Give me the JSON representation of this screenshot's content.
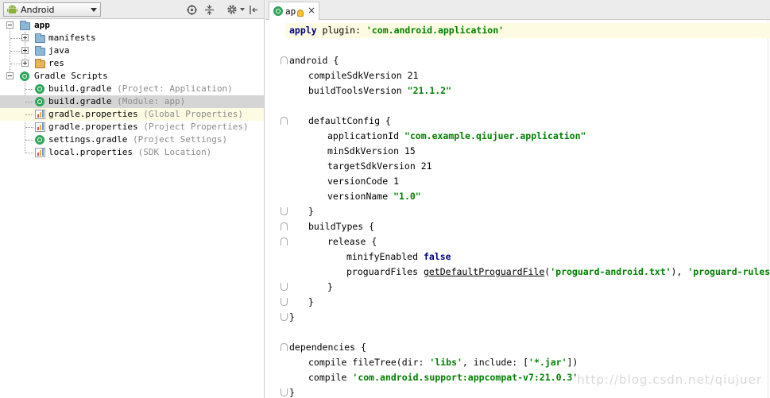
{
  "left_panel": {
    "view_selector": {
      "label": "Android",
      "icon": "android-icon"
    },
    "toolbar_icons": [
      "scroll-from-source-icon",
      "collapse-all-icon",
      "settings-gear-icon",
      "hide-panel-icon"
    ],
    "tree": [
      {
        "label": "app",
        "hint": "",
        "icon": "module-folder-icon",
        "expander": "minus",
        "bold": true
      },
      {
        "label": "manifests",
        "hint": "",
        "icon": "folder-icon",
        "expander": "plus"
      },
      {
        "label": "java",
        "hint": "",
        "icon": "folder-icon",
        "expander": "plus"
      },
      {
        "label": "res",
        "hint": "",
        "icon": "resource-folder-icon",
        "expander": "plus"
      },
      {
        "label": "Gradle Scripts",
        "hint": "",
        "icon": "gradle-icon",
        "expander": "minus"
      },
      {
        "label": "build.gradle",
        "hint": "(Project: Application)",
        "icon": "gradle-icon"
      },
      {
        "label": "build.gradle",
        "hint": "(Module: app)",
        "icon": "gradle-icon",
        "selected": true
      },
      {
        "label": "gradle.properties",
        "hint": "(Global Properties)",
        "icon": "properties-icon",
        "highlighted": true
      },
      {
        "label": "gradle.properties",
        "hint": "(Project Properties)",
        "icon": "properties-icon"
      },
      {
        "label": "settings.gradle",
        "hint": "(Project Settings)",
        "icon": "gradle-icon"
      },
      {
        "label": "local.properties",
        "hint": "(SDK Location)",
        "icon": "properties-icon"
      }
    ]
  },
  "editor": {
    "tab": {
      "label": "ap",
      "icon": "gradle-icon",
      "close": "×"
    },
    "code": {
      "l1_kw": "apply",
      "l1_pm": " plugin",
      "l1_colon": ": ",
      "l1_str": "'com.android.application'",
      "l3": "android {",
      "l4_name": "compileSdkVersion",
      "l4_num": "21",
      "l5_name": "buildToolsVersion",
      "l5_str": "\"21.1.2\"",
      "l7": "defaultConfig {",
      "l8_name": "applicationId",
      "l8_str": "\"com.example.qiujuer.application\"",
      "l9_name": "minSdkVersion",
      "l9_num": "15",
      "l10_name": "targetSdkVersion",
      "l10_num": "21",
      "l11_name": "versionCode",
      "l11_num": "1",
      "l12_name": "versionName",
      "l12_str": "\"1.0\"",
      "l13": "}",
      "l14": "buildTypes {",
      "l15": "release {",
      "l16_name": "minifyEnabled",
      "l16_val": "false",
      "l17_name": "proguardFiles",
      "l17_fn": "getDefaultProguardFile",
      "l17_p1": "(",
      "l17_s1": "'proguard-android.txt'",
      "l17_p2": "), ",
      "l17_s2": "'proguard-rules.pro'",
      "l18": "}",
      "l19": "}",
      "l20": "}",
      "l22": "dependencies {",
      "l23_name": "compile",
      "l23_fn": "fileTree",
      "l23_p1": "(",
      "l23_pm1": "dir",
      "l23_c1": ": ",
      "l23_s1": "'libs'",
      "l23_cm": ", ",
      "l23_pm2": "include",
      "l23_c2": ": [",
      "l23_s2": "'*.jar'",
      "l23_end": "])",
      "l24_name": "compile",
      "l24_str": "'com.android.support:appcompat-v7:21.0.3'",
      "l25": "}"
    }
  },
  "watermark": "http://blog.csdn.net/qiujuer",
  "colors": {
    "keyword": "#000080",
    "string": "#008000",
    "param": "#660e7a",
    "number": "#0000ff",
    "current_line": "#fdfbe2",
    "selection": "#d5d5d5"
  }
}
